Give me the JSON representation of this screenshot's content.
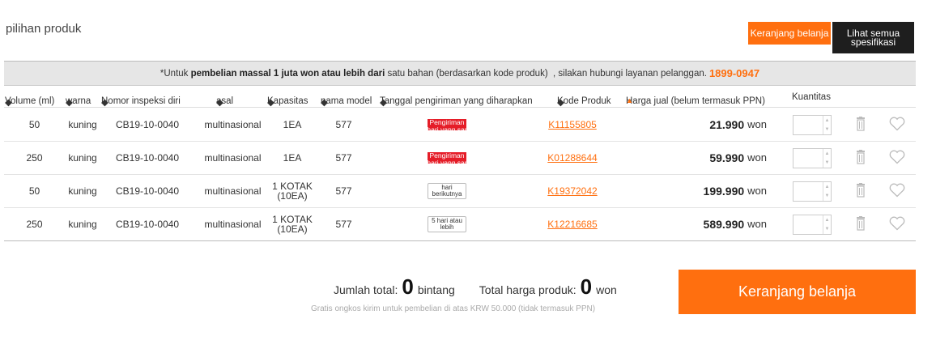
{
  "page": {
    "title": "pilihan produk"
  },
  "buttons": {
    "cart_small": "Keranjang belanja",
    "specs_line1": "Lihat semua",
    "specs_line2": "spesifikasi",
    "cart_big": "Keranjang belanja"
  },
  "notice": {
    "prefix": "*Untuk ",
    "bold": "pembelian massal 1 juta won atau lebih dari",
    "middle": " satu bahan (berdasarkan kode produk)  , silakan hubungi layanan pelanggan.",
    "phone": "1899-0947"
  },
  "columns": {
    "volume": "Volume (ml)",
    "warna": "warna",
    "nomor": "Nomor inspeksi diri",
    "asal": "asal",
    "kapasitas": "Kapasitas",
    "model": "nama model",
    "tanggal": "Tanggal pengiriman yang diharapkan",
    "kode": "Kode Produk",
    "harga": "Harga jual (belum termasuk PPN)",
    "kuantitas": "Kuantitas"
  },
  "rows": [
    {
      "volume": "50",
      "warna": "kuning",
      "nomor": "CB19-10-0040",
      "asal": "multinasional",
      "kapasitas": "1EA",
      "model": "577",
      "delivery_type": "red",
      "delivery_line1": "Pengiriman",
      "delivery_line2": "di hari yang sama",
      "kode": "K11155805",
      "harga": "21.990",
      "currency": "won"
    },
    {
      "volume": "250",
      "warna": "kuning",
      "nomor": "CB19-10-0040",
      "asal": "multinasional",
      "kapasitas": "1EA",
      "model": "577",
      "delivery_type": "red",
      "delivery_line1": "Pengiriman",
      "delivery_line2": "di hari yang sama",
      "kode": "K01288644",
      "harga": "59.990",
      "currency": "won"
    },
    {
      "volume": "50",
      "warna": "kuning",
      "nomor": "CB19-10-0040",
      "asal": "multinasional",
      "kapasitas": "1 KOTAK (10EA)",
      "model": "577",
      "delivery_type": "box",
      "delivery_line1": "hari",
      "delivery_line2": "berikutnya",
      "kode": "K19372042",
      "harga": "199.990",
      "currency": "won"
    },
    {
      "volume": "250",
      "warna": "kuning",
      "nomor": "CB19-10-0040",
      "asal": "multinasional",
      "kapasitas": "1 KOTAK (10EA)",
      "model": "577",
      "delivery_type": "box",
      "delivery_line1": "5 hari atau",
      "delivery_line2": "lebih",
      "kode": "K12216685",
      "harga": "589.990",
      "currency": "won"
    }
  ],
  "summary": {
    "total_label": "Jumlah total:",
    "total_value": "0",
    "total_unit": "bintang",
    "price_label": "Total harga produk:",
    "price_value": "0",
    "price_unit": "won",
    "note": "Gratis ongkos kirim untuk pembelian di atas KRW 50.000 (tidak termasuk PPN)"
  },
  "colors": {
    "accent": "#ff6f0f",
    "dark": "#1e1e1e",
    "badge_red": "#e51d28"
  },
  "icons": {
    "sort": "sort-diamond-icon",
    "sort_active": "sort-up-icon",
    "delete": "trash-icon",
    "wishlist": "heart-icon",
    "stepper": "stepper-icon"
  }
}
